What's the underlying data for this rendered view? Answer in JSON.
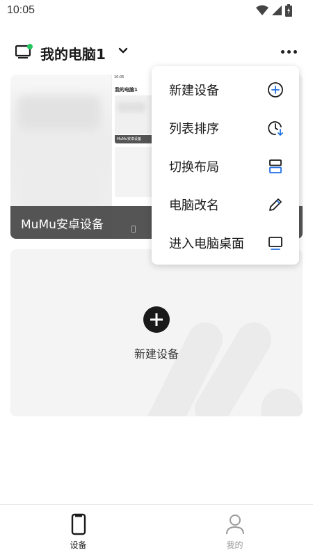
{
  "status_bar": {
    "time": "10:05"
  },
  "header": {
    "title": "我的电脑1"
  },
  "device_card": {
    "label": "MuMu安卓设备",
    "mini": {
      "time": "10:05",
      "title": "我的电脑1",
      "label": "MuMu安卓设备"
    }
  },
  "add_card": {
    "label": "新建设备"
  },
  "menu": {
    "items": [
      {
        "label": "新建设备",
        "icon": "plus-circle-icon"
      },
      {
        "label": "列表排序",
        "icon": "sort-clock-icon"
      },
      {
        "label": "切换布局",
        "icon": "layout-icon"
      },
      {
        "label": "电脑改名",
        "icon": "pencil-icon"
      },
      {
        "label": "进入电脑桌面",
        "icon": "desktop-icon"
      }
    ]
  },
  "bottom_nav": {
    "items": [
      {
        "label": "设备",
        "icon": "phone-icon",
        "active": true
      },
      {
        "label": "我的",
        "icon": "person-icon",
        "active": false
      }
    ]
  },
  "colors": {
    "online": "#22c55e",
    "accent": "#1e6fe0",
    "active_nav": "#1a1a1a",
    "inactive_nav": "#9a9a9a"
  }
}
